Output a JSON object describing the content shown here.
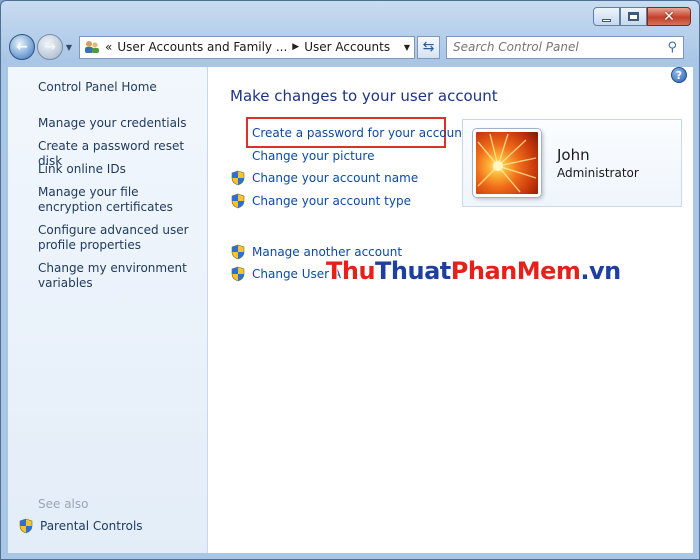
{
  "window": {
    "controls": {
      "minimize": "minimize",
      "maximize": "maximize",
      "close": "close"
    }
  },
  "nav": {
    "breadcrumb": [
      "User Accounts and Family ...",
      "User Accounts"
    ],
    "breadcrumb_prefix": "«",
    "search_placeholder": "Search Control Panel"
  },
  "sidebar": {
    "home": "Control Panel Home",
    "links": [
      "Manage your credentials",
      "Create a password reset disk",
      "Link online IDs",
      "Manage your file encryption certificates",
      "Configure advanced user profile properties",
      "Change my environment variables"
    ],
    "see_also_title": "See also",
    "see_also": [
      "Parental Controls"
    ]
  },
  "main": {
    "heading": "Make changes to your user account",
    "tasks": [
      {
        "label": "Create a password for your account",
        "shield": false,
        "highlighted": true
      },
      {
        "label": "Change your picture",
        "shield": false
      },
      {
        "label": "Change your account name",
        "shield": true
      },
      {
        "label": "Change your account type",
        "shield": true
      }
    ],
    "more_tasks": [
      {
        "label": "Manage another account",
        "shield": true
      },
      {
        "label": "Change User A",
        "shield": true
      }
    ],
    "help": "?"
  },
  "account": {
    "name": "John",
    "role": "Administrator"
  },
  "watermark": {
    "part1": "Thu",
    "part2": "Thuat",
    "part3": "PhanMem",
    "part4": ".vn"
  },
  "colors": {
    "link": "#0b4aa5",
    "heading": "#1e3287",
    "highlight": "#d9312b"
  }
}
